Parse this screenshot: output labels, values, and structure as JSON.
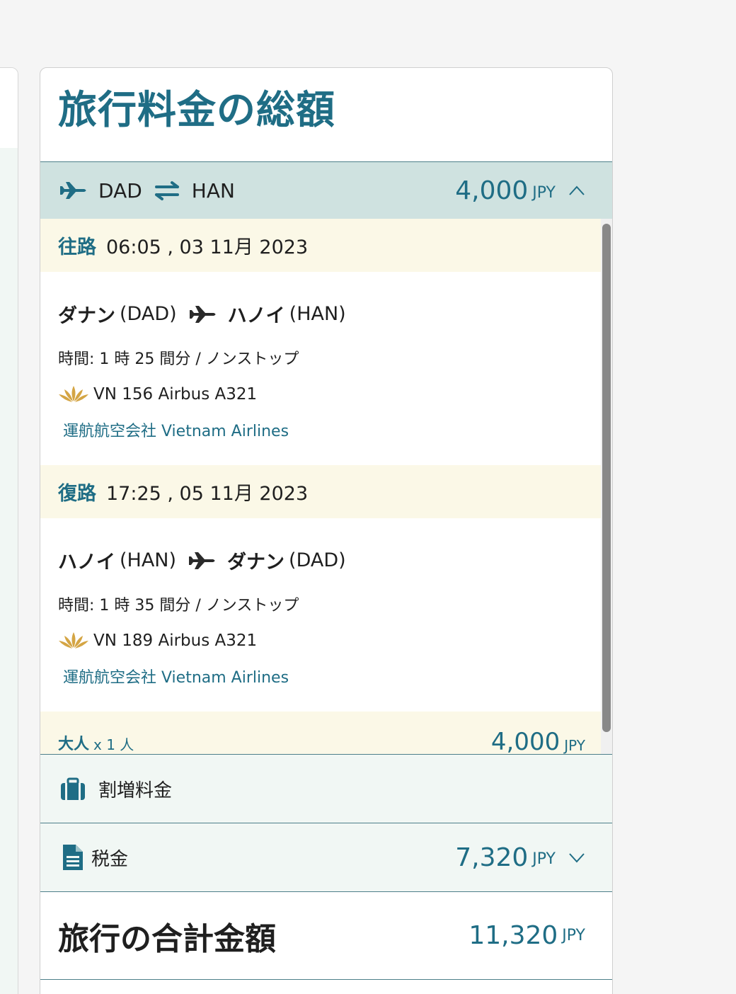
{
  "title": "旅行料金の総額",
  "route": {
    "origin": "DAD",
    "destination": "HAN",
    "amount": "4,000",
    "currency": "JPY"
  },
  "outbound": {
    "direction_label": "往路",
    "datetime": "06:05 , 03 11月 2023",
    "from_city": "ダナン",
    "from_code": "(DAD)",
    "to_city": "ハノイ",
    "to_code": "(HAN)",
    "duration": "時間: 1 時 25 間分 / ノンストップ",
    "flight": "VN 156 Airbus A321",
    "operator": "運航航空会社 Vietnam Airlines"
  },
  "inbound": {
    "direction_label": "復路",
    "datetime": "17:25 , 05 11月 2023",
    "from_city": "ハノイ",
    "from_code": "(HAN)",
    "to_city": "ダナン",
    "to_code": "(DAD)",
    "duration": "時間: 1 時 35 間分 / ノンストップ",
    "flight": "VN 189 Airbus A321",
    "operator": "運航航空会社 Vietnam Airlines"
  },
  "passengers": {
    "label": "大人",
    "multiplier": "x 1 人",
    "amount": "4,000",
    "currency": "JPY"
  },
  "surcharge": {
    "label": "割増料金"
  },
  "taxes": {
    "label": "税金",
    "amount": "7,320",
    "currency": "JPY"
  },
  "total": {
    "label": "旅行の合計金額",
    "amount": "11,320",
    "currency": "JPY"
  },
  "colors": {
    "accent": "#1f6d85",
    "route_bg": "#cfe2e0",
    "segment_bg": "#fbf8e7",
    "fee_bg": "#f1f7f4",
    "lotus": "#d4a544"
  },
  "icons": {
    "route": "plane-icon",
    "swap": "swap-arrows-icon",
    "expand": "chevron-up-icon",
    "collapse": "chevron-down-icon",
    "surcharge": "luggage-icon",
    "taxes": "document-icon",
    "airline": "lotus-icon"
  }
}
